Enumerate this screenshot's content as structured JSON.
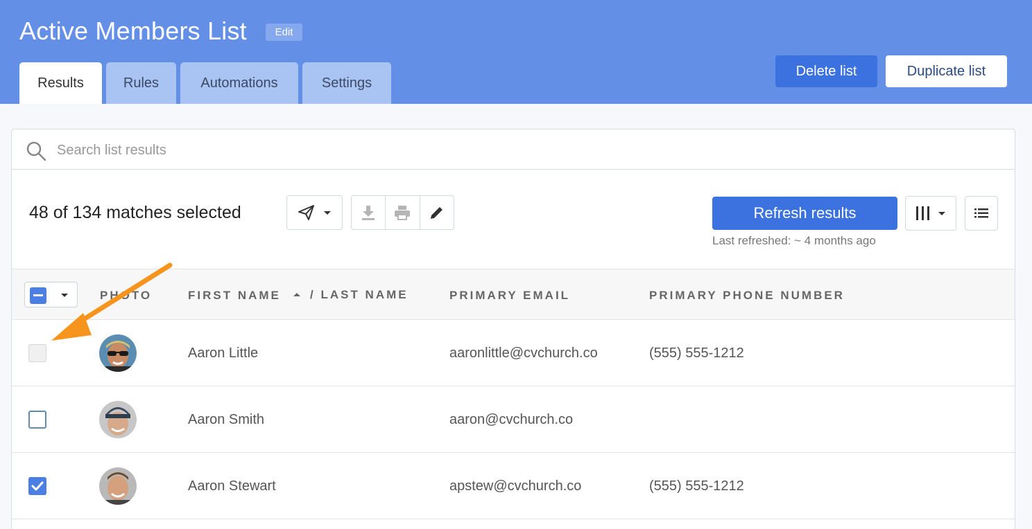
{
  "header": {
    "title": "Active Members List",
    "edit_label": "Edit",
    "tabs": [
      {
        "label": "Results",
        "active": true
      },
      {
        "label": "Rules",
        "active": false
      },
      {
        "label": "Automations",
        "active": false
      },
      {
        "label": "Settings",
        "active": false
      }
    ],
    "delete_label": "Delete list",
    "duplicate_label": "Duplicate list"
  },
  "search": {
    "placeholder": "Search list results",
    "value": ""
  },
  "toolbar": {
    "selected_count": "48 of 134 matches selected",
    "refresh_label": "Refresh results",
    "last_refreshed": "Last refreshed: ~ 4 months ago",
    "icons": [
      "send-icon",
      "chevron-down-icon",
      "download-icon",
      "print-icon",
      "pencil-icon",
      "columns-icon",
      "list-icon"
    ]
  },
  "table": {
    "columns": {
      "photo": "PHOTO",
      "first_name": "FIRST NAME",
      "last_name": "/ LAST NAME",
      "email": "PRIMARY EMAIL",
      "phone": "PRIMARY PHONE NUMBER"
    },
    "rows": [
      {
        "name": "Aaron Little",
        "email": "aaronlittle@cvchurch.co",
        "phone": "(555) 555-1212",
        "checkbox": "disabled"
      },
      {
        "name": "Aaron Smith",
        "email": "aaron@cvchurch.co",
        "phone": "",
        "checkbox": "unchecked"
      },
      {
        "name": "Aaron Stewart",
        "email": "apstew@cvchurch.co",
        "phone": "(555) 555-1212",
        "checkbox": "checked"
      }
    ]
  },
  "colors": {
    "header_bg": "#6390e6",
    "primary_button": "#3c72e0",
    "annotation_arrow": "#f7941d"
  }
}
